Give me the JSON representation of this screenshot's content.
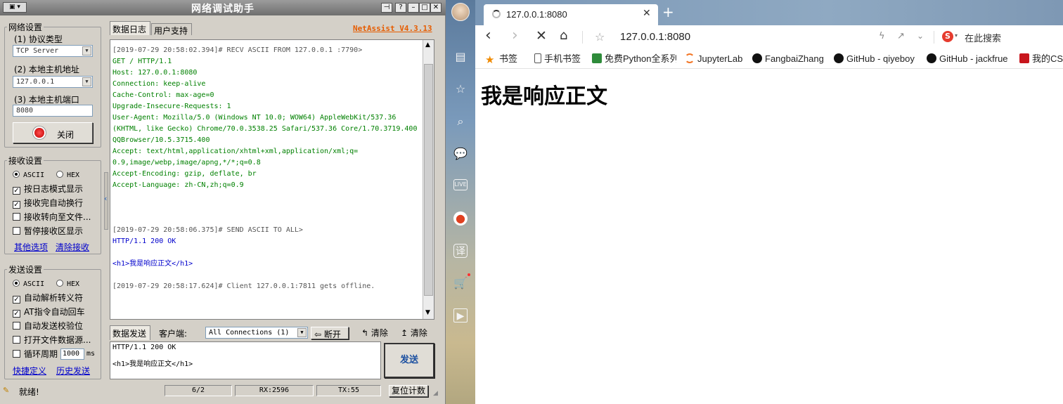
{
  "app": {
    "title": "网络调试助手",
    "version": "NetAssist V4.3.13",
    "network": {
      "group_label": "网络设置",
      "protocol_label": "(1) 协议类型",
      "protocol_value": "TCP Server",
      "host_label": "(2) 本地主机地址",
      "host_value": "127.0.0.1",
      "port_label": "(3) 本地主机端口",
      "port_value": "8080",
      "close_button": "关闭"
    },
    "receive": {
      "group_label": "接收设置",
      "ascii": "ASCII",
      "hex": "HEX",
      "options": [
        "按日志模式显示",
        "接收完自动换行",
        "接收转向至文件...",
        "暂停接收区显示"
      ],
      "checked": [
        true,
        true,
        false,
        false
      ],
      "link_more": "其他选项",
      "link_clear": "清除接收"
    },
    "send": {
      "group_label": "发送设置",
      "ascii": "ASCII",
      "hex": "HEX",
      "options": [
        "自动解析转义符",
        "AT指令自动回车",
        "自动发送校验位",
        "打开文件数据源..."
      ],
      "checked": [
        true,
        true,
        false,
        false
      ],
      "loop_label": "循环周期",
      "loop_value": "1000",
      "loop_unit": "ms",
      "link_shortcut": "快捷定义",
      "link_history": "历史发送"
    },
    "tabs": [
      "数据日志",
      "用户支持"
    ],
    "log": [
      {
        "text": "[2019-07-29 20:58:02.394]# RECV ASCII FROM 127.0.0.1 :7790>",
        "color": "gray"
      },
      {
        "text": "GET / HTTP/1.1",
        "color": "green"
      },
      {
        "text": "Host: 127.0.0.1:8080",
        "color": "green"
      },
      {
        "text": "Connection: keep-alive",
        "color": "green"
      },
      {
        "text": "Cache-Control: max-age=0",
        "color": "green"
      },
      {
        "text": "Upgrade-Insecure-Requests: 1",
        "color": "green"
      },
      {
        "text": "User-Agent: Mozilla/5.0 (Windows NT 10.0; WOW64) AppleWebKit/537.36",
        "color": "green"
      },
      {
        "text": "(KHTML, like Gecko) Chrome/70.0.3538.25 Safari/537.36 Core/1.70.3719.400",
        "color": "green"
      },
      {
        "text": "QQBrowser/10.5.3715.400",
        "color": "green"
      },
      {
        "text": "Accept: text/html,application/xhtml+xml,application/xml;q=",
        "color": "green"
      },
      {
        "text": "0.9,image/webp,image/apng,*/*;q=0.8",
        "color": "green"
      },
      {
        "text": "Accept-Encoding: gzip, deflate, br",
        "color": "green"
      },
      {
        "text": "Accept-Language: zh-CN,zh;q=0.9",
        "color": "green"
      },
      {
        "text": "[2019-07-29 20:58:06.375]# SEND ASCII TO ALL>",
        "color": "gray"
      },
      {
        "text": "HTTP/1.1 200 OK",
        "color": "blue"
      },
      {
        "text": "<h1>我是响应正文</h1>",
        "color": "blue"
      },
      {
        "text": "[2019-07-29 20:58:17.624]# Client 127.0.0.1:7811 gets offline.",
        "color": "gray"
      }
    ],
    "sendbar": {
      "send_tab": "数据发送",
      "client_label": "客户端:",
      "client_value": "All Connections (1)",
      "disconnect": "断开",
      "clear1": "清除",
      "clear2": "清除"
    },
    "send_text": [
      "HTTP/1.1 200 OK",
      "",
      "<h1>我是响应正文</h1>"
    ],
    "send_button": "发送",
    "status": {
      "ready": "就绪!",
      "count": "6/2",
      "rx": "RX:2596",
      "tx": "TX:55",
      "reset": "复位计数"
    }
  },
  "browser": {
    "tab_title": "127.0.0.1:8080",
    "url": "127.0.0.1:8080",
    "search_placeholder": "在此搜索",
    "bookmarks": [
      "书签",
      "手机书签",
      "免费Python全系列",
      "JupyterLab",
      "FangbaiZhang",
      "GitHub - qiyeboy",
      "GitHub - jackfrue",
      "我的CSDN"
    ],
    "page_heading": "我是响应正文"
  }
}
